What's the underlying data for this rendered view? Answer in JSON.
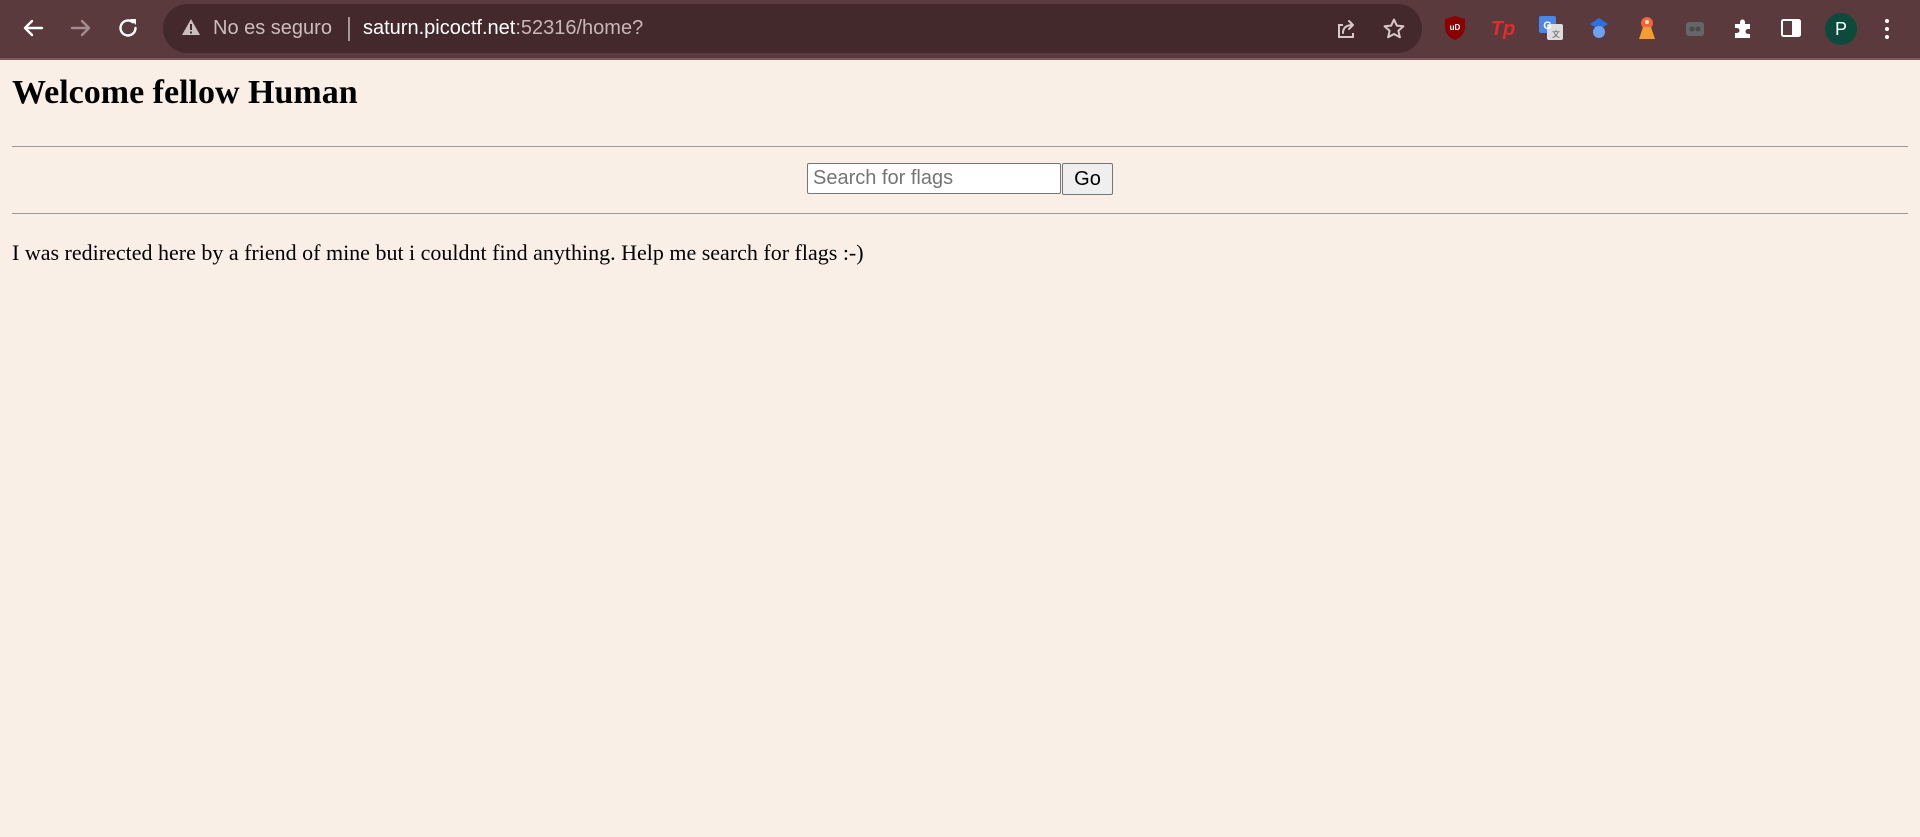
{
  "browser": {
    "security_label": "No es seguro",
    "url_host": "saturn.picoctf.net",
    "url_rest": ":52316/home?",
    "profile_initial": "P",
    "toolbar_color": "#5a3a3d",
    "omnibox_color": "#43282c",
    "extensions": [
      {
        "name": "ublock-origin-icon",
        "label": "uD",
        "color": "#8b0000"
      },
      {
        "name": "tampermonkey-icon",
        "label": "Tp",
        "color": "#e32b2b"
      },
      {
        "name": "google-translate-icon",
        "label": "G",
        "color": "#4a86e8"
      },
      {
        "name": "blue-extension-icon",
        "label": "",
        "color": "#4a86e8"
      },
      {
        "name": "orange-extension-icon",
        "label": "",
        "color": "#f0653c"
      },
      {
        "name": "gray-extension-icon",
        "label": "",
        "color": "#666666"
      }
    ]
  },
  "page": {
    "title": "Welcome fellow Human",
    "search_placeholder": "Search for flags",
    "search_value": "",
    "go_label": "Go",
    "message": "I was redirected here by a friend of mine but i couldnt find anything. Help me search for flags :-)",
    "background_color": "#faefe6"
  }
}
